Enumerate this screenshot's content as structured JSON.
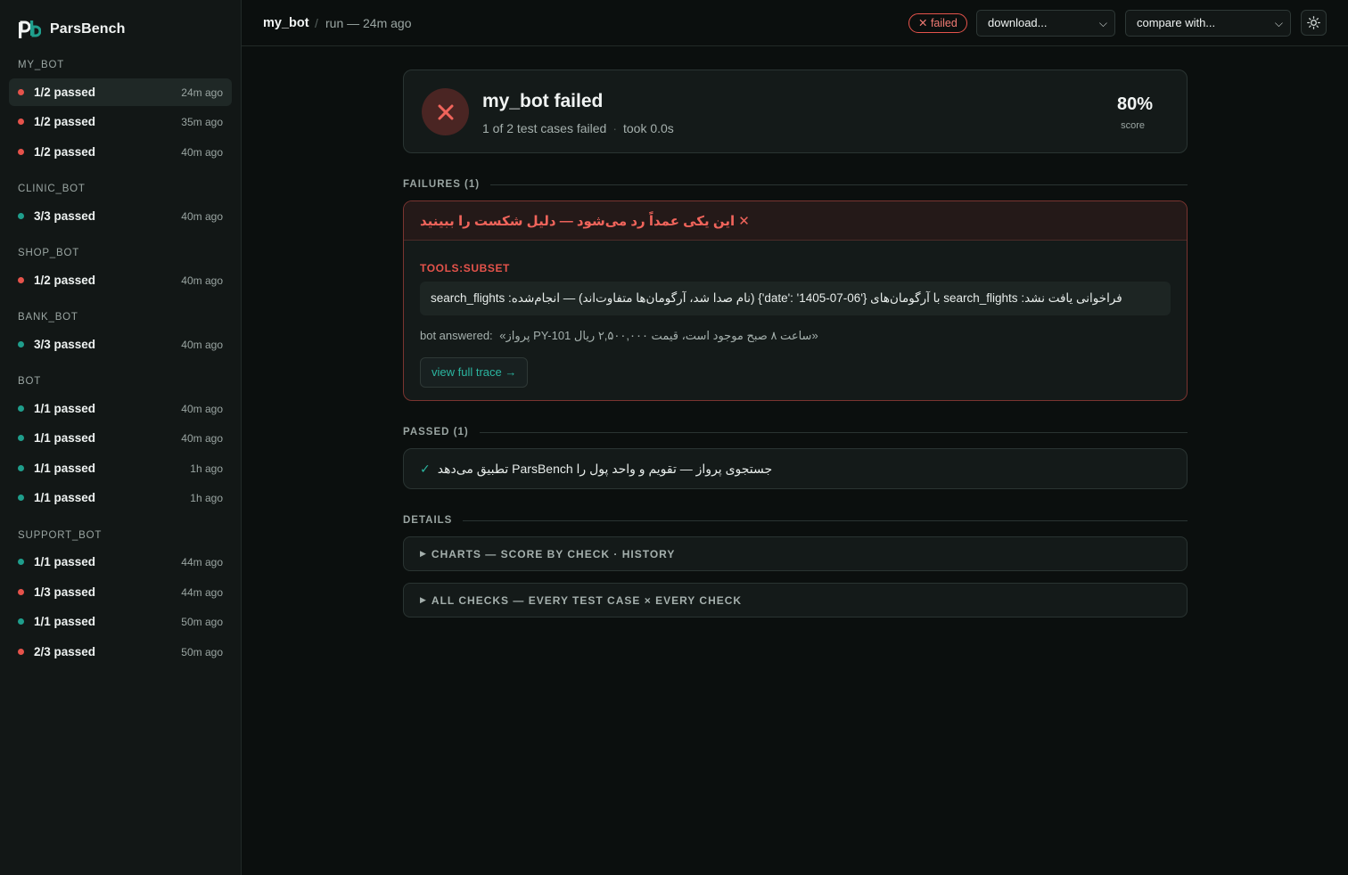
{
  "app": {
    "name": "ParsBench"
  },
  "sidebar": {
    "groups": [
      {
        "title": "MY_BOT",
        "runs": [
          {
            "label": "1/2 passed",
            "time": "24m ago",
            "status": "fail",
            "active": true
          },
          {
            "label": "1/2 passed",
            "time": "35m ago",
            "status": "fail"
          },
          {
            "label": "1/2 passed",
            "time": "40m ago",
            "status": "fail"
          }
        ]
      },
      {
        "title": "CLINIC_BOT",
        "runs": [
          {
            "label": "3/3 passed",
            "time": "40m ago",
            "status": "pass"
          }
        ]
      },
      {
        "title": "SHOP_BOT",
        "runs": [
          {
            "label": "1/2 passed",
            "time": "40m ago",
            "status": "fail"
          }
        ]
      },
      {
        "title": "BANK_BOT",
        "runs": [
          {
            "label": "3/3 passed",
            "time": "40m ago",
            "status": "pass"
          }
        ]
      },
      {
        "title": "BOT",
        "runs": [
          {
            "label": "1/1 passed",
            "time": "40m ago",
            "status": "pass"
          },
          {
            "label": "1/1 passed",
            "time": "40m ago",
            "status": "pass"
          },
          {
            "label": "1/1 passed",
            "time": "1h ago",
            "status": "pass"
          },
          {
            "label": "1/1 passed",
            "time": "1h ago",
            "status": "pass"
          }
        ]
      },
      {
        "title": "SUPPORT_BOT",
        "runs": [
          {
            "label": "1/1 passed",
            "time": "44m ago",
            "status": "pass"
          },
          {
            "label": "1/3 passed",
            "time": "44m ago",
            "status": "fail"
          },
          {
            "label": "1/1 passed",
            "time": "50m ago",
            "status": "pass"
          },
          {
            "label": "2/3 passed",
            "time": "50m ago",
            "status": "fail"
          }
        ]
      }
    ]
  },
  "topbar": {
    "bot": "my_bot",
    "separator": "/",
    "run": "run — 24m ago",
    "status": "✕ failed",
    "download_label": "download...",
    "compare_label": "compare with..."
  },
  "summary": {
    "title": "my_bot failed",
    "subtitle": "1 of 2 test cases failed",
    "dot": "·",
    "duration": "took 0.0s",
    "score": "80%",
    "score_label": "score"
  },
  "failures": {
    "heading": "FAILURES (1)",
    "items": [
      {
        "title": "✕ این یکی عمداً رد می‌شود — دلیل شکست را ببینید",
        "check": "TOOLS:SUBSET",
        "message": "فراخوانی یافت نشد: search_flights با آرگومان‌های {'date': '1405-07-06'} (نام صدا شد، آرگومان‌ها متفاوت‌اند) — انجام‌شده: search_flights",
        "answer_label": "bot answered:",
        "answer": "«پرواز PY-101 ساعت ۸ صبح موجود است، قیمت ۲,۵۰۰,۰۰۰ ریال»",
        "trace_label": "view full trace →"
      }
    ]
  },
  "passed": {
    "heading": "PASSED (1)",
    "items": [
      {
        "label": "جستجوی پرواز — تقویم و واحد پول را ParsBench تطبیق می‌دهد"
      }
    ]
  },
  "details": {
    "heading": "DETAILS",
    "charts_label": "CHARTS — SCORE BY CHECK · HISTORY",
    "checks_label": "ALL CHECKS — EVERY TEST CASE × EVERY CHECK"
  },
  "colors": {
    "fail": "#e5534b",
    "pass": "#1f9e8c",
    "accent": "#2bb5a0"
  }
}
